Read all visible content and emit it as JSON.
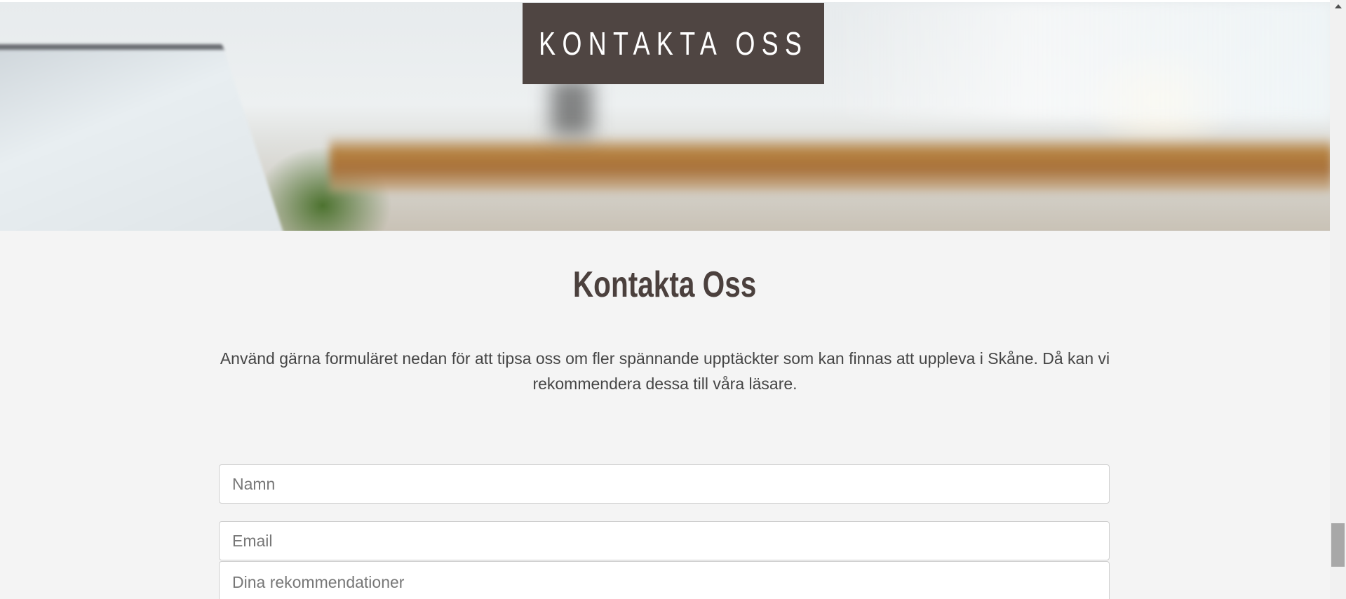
{
  "hero": {
    "banner_title": "KONTAKTA OSS"
  },
  "main": {
    "heading": "Kontakta Oss",
    "intro": "Använd gärna formuläret nedan för att tipsa oss om fler spännande upptäckter som kan finnas att uppleva i Skåne. Då kan vi rekommendera dessa till våra läsare."
  },
  "form": {
    "name_placeholder": "Namn",
    "email_placeholder": "Email",
    "recommendations_placeholder": "Dina rekommendationer"
  },
  "colors": {
    "banner_bg": "#4f4542",
    "heading_text": "#4b403d",
    "page_bg": "#f4f4f4"
  },
  "icons": {
    "scroll_up": "scroll-up-arrow-icon"
  }
}
